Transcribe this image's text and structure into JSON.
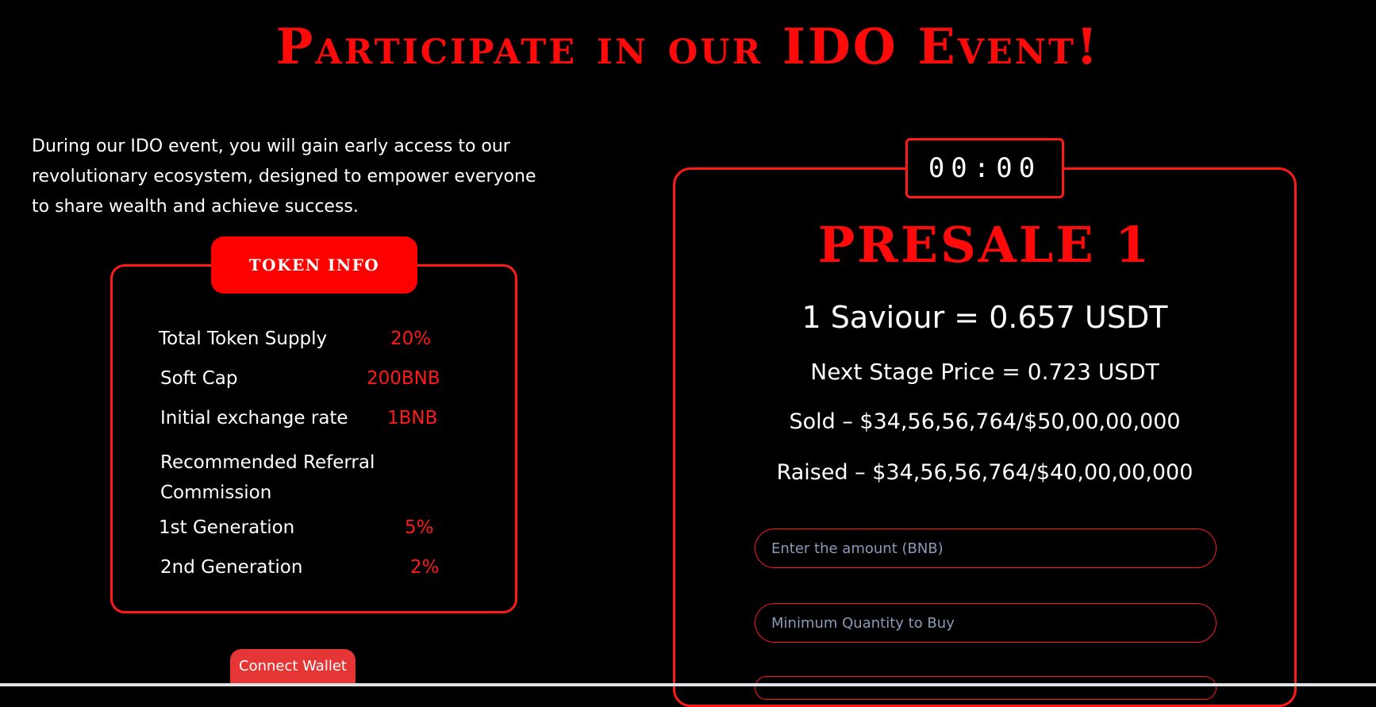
{
  "heading": "Participate in our IDO Event!",
  "intro": "During our IDO event, you will gain early access to our revolutionary ecosystem, designed to empower everyone to share wealth and achieve success.",
  "token_info": {
    "tab_label": "TOKEN INFO",
    "rows": [
      {
        "label": "Total Token Supply",
        "value": "20%"
      },
      {
        "label": "Soft Cap",
        "value": "200BNB"
      },
      {
        "label": "Initial exchange rate",
        "value": "1BNB"
      },
      {
        "label": "Recommended Referral Commission",
        "value": ""
      },
      {
        "label": "1st Generation",
        "value": "5%"
      },
      {
        "label": "2nd Generation",
        "value": "2%"
      }
    ]
  },
  "connect_wallet_label": "Connect Wallet",
  "presale": {
    "timer": "00:00",
    "title": "PRESALE 1",
    "price": "1 Saviour = 0.657 USDT",
    "next_price": "Next Stage Price = 0.723 USDT",
    "sold": "Sold – $34,56,56,764/$50,00,00,000",
    "raised": "Raised – $34,56,56,764/$40,00,00,000",
    "amount_placeholder": "Enter the amount (BNB)",
    "min_qty_placeholder": "Minimum Quantity to Buy"
  },
  "colors": {
    "accent": "#ff0a0a",
    "background": "#000000",
    "text": "#ffffff",
    "placeholder": "#8a9bb8"
  }
}
